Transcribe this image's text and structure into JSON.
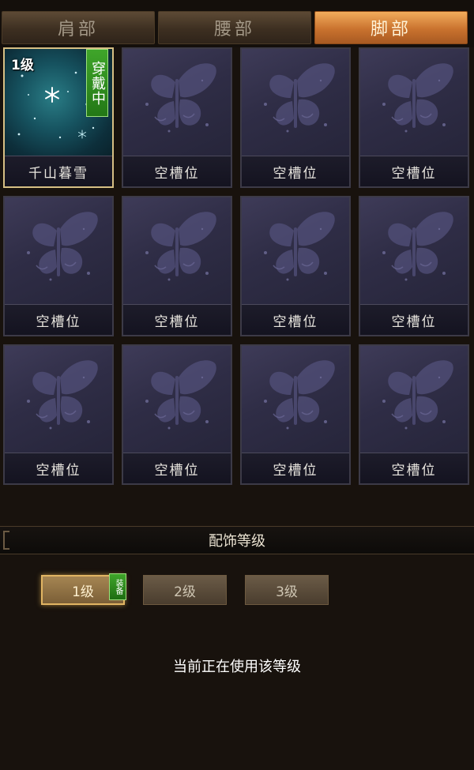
{
  "tabs": [
    {
      "label": "肩部",
      "active": false
    },
    {
      "label": "腰部",
      "active": false
    },
    {
      "label": "脚部",
      "active": true
    }
  ],
  "slots": [
    {
      "label": "千山暮雪",
      "level_tag": "1级",
      "badge": "穿戴中",
      "equipped": true
    },
    {
      "label": "空槽位"
    },
    {
      "label": "空槽位"
    },
    {
      "label": "空槽位"
    },
    {
      "label": "空槽位"
    },
    {
      "label": "空槽位"
    },
    {
      "label": "空槽位"
    },
    {
      "label": "空槽位"
    },
    {
      "label": "空槽位"
    },
    {
      "label": "空槽位"
    },
    {
      "label": "空槽位"
    },
    {
      "label": "空槽位"
    }
  ],
  "level_section": {
    "title": "配饰等级",
    "levels": [
      {
        "label": "1级",
        "active": true,
        "tag": "装备"
      },
      {
        "label": "2级",
        "active": false
      },
      {
        "label": "3级",
        "active": false
      }
    ],
    "status": "当前正在使用该等级"
  },
  "icons": {
    "empty_slot": "butterfly-icon",
    "equipped_item": "snowflake-icon"
  },
  "colors": {
    "accent_tab": "#e08a3c",
    "equipped_badge": "#3fa52a",
    "slot_border_selected": "#d6bf84"
  }
}
